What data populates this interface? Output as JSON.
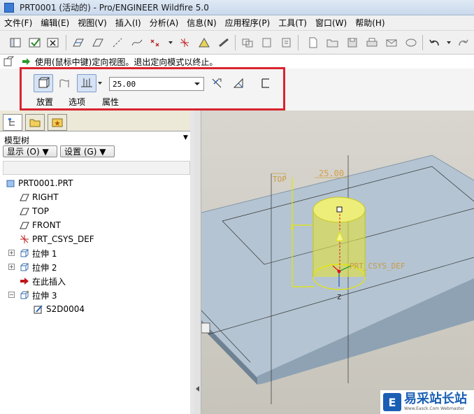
{
  "window": {
    "title": "PRT0001 (活动的) - Pro/ENGINEER Wildfire 5.0"
  },
  "menu": [
    "文件(F)",
    "编辑(E)",
    "视图(V)",
    "插入(I)",
    "分析(A)",
    "信息(N)",
    "应用程序(P)",
    "工具(T)",
    "窗口(W)",
    "帮助(H)"
  ],
  "message": {
    "text": "使用(鼠标中键)定向视图。退出定向模式以终止。"
  },
  "dashboard": {
    "depth_value": "25.00",
    "tabs": {
      "placement": "放置",
      "options": "选项",
      "properties": "属性"
    }
  },
  "model_tree": {
    "title": "模型树",
    "show_button": "显示 (O) ▼",
    "settings_button": "设置 (G) ▼",
    "nodes": [
      "PRT0001.PRT",
      "RIGHT",
      "TOP",
      "FRONT",
      "PRT_CSYS_DEF",
      "拉伸 1",
      "拉伸 2",
      "在此插入",
      "拉伸 3",
      "S2D0004"
    ]
  },
  "graphics": {
    "datum_top_label": "TOP",
    "dimension_value": "25.00",
    "csys_label": "PRT_CSYS_DEF",
    "axis_z_label": "Z"
  },
  "watermark": {
    "logo": "E",
    "main": "易采站长站",
    "sub": "Www.Easck.Com Webmaster"
  },
  "colors": {
    "highlight_frame": "#d9232e",
    "preview_yellow": "#e3e33a",
    "datum_orange": "#d4a04a"
  }
}
